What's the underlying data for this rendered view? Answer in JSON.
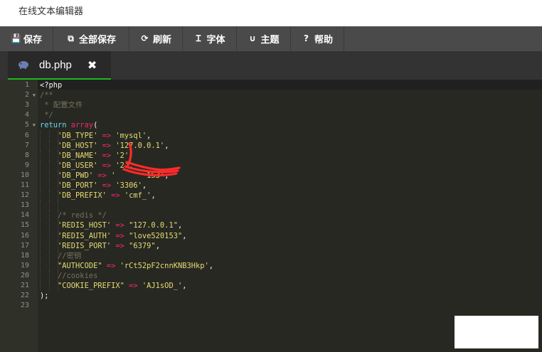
{
  "window": {
    "title": "在线文本编辑器"
  },
  "toolbar": {
    "buttons": [
      {
        "label": "保存",
        "icon": "floppy-save-icon",
        "glyph": "💾"
      },
      {
        "label": "全部保存",
        "icon": "save-all-icon",
        "glyph": "⧉"
      },
      {
        "label": "刷新",
        "icon": "refresh-icon",
        "glyph": "⟳"
      },
      {
        "label": "字体",
        "icon": "text-font-icon",
        "glyph": "Ɪ"
      },
      {
        "label": "主题",
        "icon": "magnet-theme-icon",
        "glyph": "∪"
      },
      {
        "label": "帮助",
        "icon": "help-circle-icon",
        "glyph": "?"
      }
    ]
  },
  "tab": {
    "label": "db.php",
    "icon": "php-elephant-icon",
    "close_glyph": "✖",
    "accent": "#1fb51f"
  },
  "editor": {
    "theme": {
      "background": "#272822",
      "gutter": "#2f3129"
    },
    "lines": [
      {
        "n": "1",
        "tokens": [
          [
            "t",
            "<?php"
          ]
        ]
      },
      {
        "n": "2",
        "fold": true,
        "tokens": [
          [
            "c",
            "/**"
          ]
        ]
      },
      {
        "n": "3",
        "tokens": [
          [
            "c",
            " * 配置文件"
          ]
        ]
      },
      {
        "n": "4",
        "tokens": [
          [
            "c",
            " */"
          ]
        ]
      },
      {
        "n": "5",
        "fold": true,
        "tokens": [
          [
            "k",
            "return "
          ],
          [
            "f",
            "array"
          ],
          [
            "t",
            "("
          ]
        ]
      },
      {
        "n": "6",
        "tokens": [
          [
            "t",
            "    "
          ],
          [
            "s",
            "'DB_TYPE'"
          ],
          [
            "o",
            " => "
          ],
          [
            "s",
            "'mysql'"
          ],
          [
            "t",
            ","
          ]
        ]
      },
      {
        "n": "7",
        "tokens": [
          [
            "t",
            "    "
          ],
          [
            "s",
            "'DB_HOST'"
          ],
          [
            "o",
            " => "
          ],
          [
            "s",
            "'127.0.0.1'"
          ],
          [
            "t",
            ","
          ]
        ]
      },
      {
        "n": "8",
        "tokens": [
          [
            "t",
            "    "
          ],
          [
            "s",
            "'DB_NAME'"
          ],
          [
            "o",
            " => "
          ],
          [
            "s",
            "'2'"
          ],
          [
            "t",
            ","
          ]
        ]
      },
      {
        "n": "9",
        "tokens": [
          [
            "t",
            "    "
          ],
          [
            "s",
            "'DB_USER'"
          ],
          [
            "o",
            " => "
          ],
          [
            "s",
            "'2'"
          ],
          [
            "t",
            ","
          ]
        ]
      },
      {
        "n": "10",
        "tokens": [
          [
            "t",
            "    "
          ],
          [
            "s",
            "'DB_PWD'"
          ],
          [
            "o",
            " => "
          ],
          [
            "s",
            "'       153'"
          ],
          [
            "t",
            ","
          ]
        ]
      },
      {
        "n": "11",
        "tokens": [
          [
            "t",
            "    "
          ],
          [
            "s",
            "'DB_PORT'"
          ],
          [
            "o",
            " => "
          ],
          [
            "s",
            "'3306'"
          ],
          [
            "t",
            ","
          ]
        ]
      },
      {
        "n": "12",
        "tokens": [
          [
            "t",
            "    "
          ],
          [
            "s",
            "'DB_PREFIX'"
          ],
          [
            "o",
            " => "
          ],
          [
            "s",
            "'cmf_'"
          ],
          [
            "t",
            ","
          ]
        ]
      },
      {
        "n": "13",
        "tokens": [
          [
            "t",
            "    "
          ]
        ]
      },
      {
        "n": "14",
        "tokens": [
          [
            "t",
            "    "
          ],
          [
            "c",
            "/* redis */"
          ]
        ]
      },
      {
        "n": "15",
        "tokens": [
          [
            "t",
            "    "
          ],
          [
            "s",
            "'REDIS_HOST'"
          ],
          [
            "o",
            " => "
          ],
          [
            "s",
            "\"127.0.0.1\""
          ],
          [
            "t",
            ","
          ]
        ]
      },
      {
        "n": "16",
        "tokens": [
          [
            "t",
            "    "
          ],
          [
            "s",
            "'REDIS_AUTH'"
          ],
          [
            "o",
            " => "
          ],
          [
            "s",
            "\"love520153\""
          ],
          [
            "t",
            ","
          ]
        ]
      },
      {
        "n": "17",
        "tokens": [
          [
            "t",
            "    "
          ],
          [
            "s",
            "'REDIS_PORT'"
          ],
          [
            "o",
            " => "
          ],
          [
            "s",
            "\"6379\""
          ],
          [
            "t",
            ","
          ]
        ]
      },
      {
        "n": "18",
        "tokens": [
          [
            "t",
            "    "
          ],
          [
            "c",
            "//密钥"
          ]
        ]
      },
      {
        "n": "19",
        "tokens": [
          [
            "t",
            "    "
          ],
          [
            "s",
            "\"AUTHCODE\""
          ],
          [
            "o",
            " => "
          ],
          [
            "s",
            "'rCt52pF2cnnKNB3Hkp'"
          ],
          [
            "t",
            ","
          ]
        ]
      },
      {
        "n": "20",
        "tokens": [
          [
            "t",
            "    "
          ],
          [
            "c",
            "//cookies"
          ]
        ]
      },
      {
        "n": "21",
        "tokens": [
          [
            "t",
            "    "
          ],
          [
            "s",
            "\"COOKIE_PREFIX\""
          ],
          [
            "o",
            " => "
          ],
          [
            "s",
            "'AJ1sOD_'"
          ],
          [
            "t",
            ","
          ]
        ]
      },
      {
        "n": "22",
        "tokens": [
          [
            "t",
            ");"
          ]
        ]
      },
      {
        "n": "23",
        "tokens": []
      }
    ],
    "redaction_color": "#ff2a2a"
  }
}
